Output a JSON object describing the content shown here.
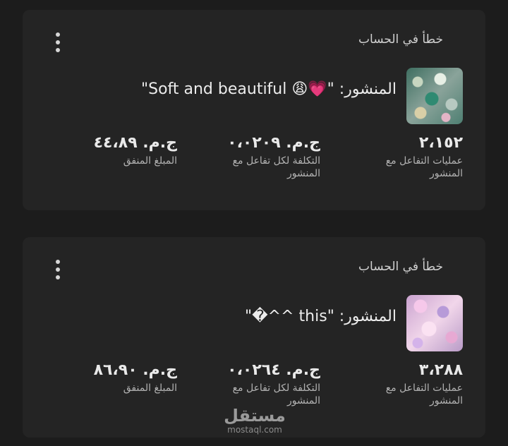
{
  "cards": [
    {
      "status": "خطأ في الحساب",
      "post_text": "المنشور: \"💗😩 Soft and beautiful\"",
      "thumbnail": "thumbnail-image",
      "stats": {
        "engagements": {
          "value": "٢،١٥٢",
          "label": "عمليات التفاعل مع المنشور"
        },
        "cost_per_engagement": {
          "value": "ج.م. ٠،٠٢٠٩",
          "label": "التكلفة لكل تفاعل مع المنشور"
        },
        "amount_spent": {
          "value": "ج.م. ٤٤،٨٩",
          "label": "المبلغ المنفق"
        }
      }
    },
    {
      "status": "خطأ في الحساب",
      "post_text": "المنشور: \"this ^^�\"",
      "thumbnail": "thumbnail-image",
      "stats": {
        "engagements": {
          "value": "٣،٢٨٨",
          "label": "عمليات التفاعل مع المنشور"
        },
        "cost_per_engagement": {
          "value": "ج.م. ٠،٠٢٦٤",
          "label": "التكلفة لكل تفاعل مع المنشور"
        },
        "amount_spent": {
          "value": "ج.م. ٨٦،٩٠",
          "label": "المبلغ المنفق"
        }
      }
    }
  ],
  "watermark": {
    "arabic": "مستقل",
    "latin": "mostaql.com"
  },
  "icons": {
    "more": "more-vertical-icon"
  },
  "colors": {
    "background": "#1c1c1c",
    "card": "#242424",
    "text": "#e4e6eb"
  }
}
